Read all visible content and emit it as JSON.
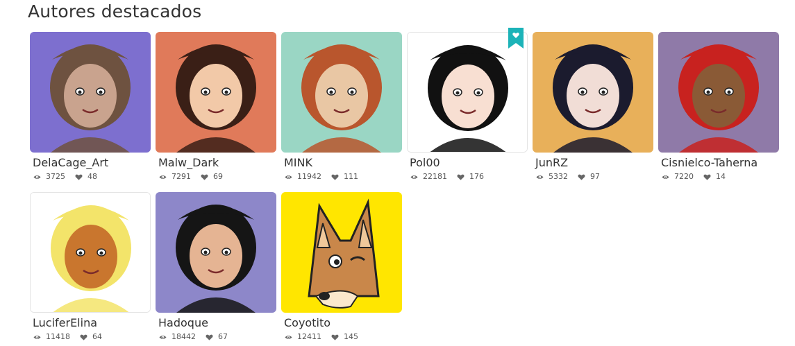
{
  "section": {
    "title": "Autores destacados"
  },
  "authors": [
    {
      "name": "DelaCage_Art",
      "views": "3725",
      "likes": "48",
      "bg": "#7d6fcf",
      "skin": "#c9a38e",
      "hair": "#6e5240",
      "featured": false
    },
    {
      "name": "Malw_Dark",
      "views": "7291",
      "likes": "69",
      "bg": "#e07a5a",
      "skin": "#f2c9a8",
      "hair": "#3a1f16",
      "featured": false
    },
    {
      "name": "MINK",
      "views": "11942",
      "likes": "111",
      "bg": "#9ad6c4",
      "skin": "#e9c7a4",
      "hair": "#b9562d",
      "featured": false
    },
    {
      "name": "Pol00",
      "views": "22181",
      "likes": "176",
      "bg": "#ffffff",
      "skin": "#f8dfd2",
      "hair": "#111111",
      "featured": true
    },
    {
      "name": "JunRZ",
      "views": "5332",
      "likes": "97",
      "bg": "#e8b05a",
      "skin": "#f1ddd6",
      "hair": "#1b1b2e",
      "featured": false
    },
    {
      "name": "Cisnielco-Taherna",
      "views": "7220",
      "likes": "14",
      "bg": "#8f7aa8",
      "skin": "#8a5a36",
      "hair": "#c8221f",
      "featured": false
    },
    {
      "name": "LuciferElina",
      "views": "11418",
      "likes": "64",
      "bg": "#ffffff",
      "skin": "#c9762e",
      "hair": "#f3e46a",
      "featured": false
    },
    {
      "name": "Hadoque",
      "views": "18442",
      "likes": "67",
      "bg": "#8d87c9",
      "skin": "#e5b493",
      "hair": "#151515",
      "featured": false
    },
    {
      "name": "Coyotito",
      "views": "12411",
      "likes": "145",
      "bg": "#ffe600",
      "skin": "#c9874a",
      "hair": "#3a2a1a",
      "featured": false
    }
  ],
  "icons": {
    "views": "eye-icon",
    "likes": "heart-icon",
    "featured": "bookmark-heart-icon"
  },
  "colors": {
    "accent": "#1cb3b8",
    "text": "#333333",
    "muted": "#555555"
  }
}
